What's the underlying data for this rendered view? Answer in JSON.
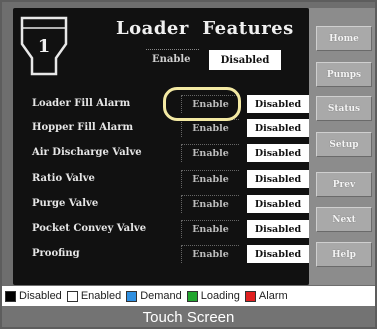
{
  "header": {
    "title": "Loader  Features",
    "loader_number": "1",
    "enable_label": "Enable",
    "disabled_label": "Disabled"
  },
  "rows": [
    {
      "label": "Loader Fill Alarm",
      "enable": "Enable",
      "disabled": "Disabled"
    },
    {
      "label": "Hopper Fill Alarm",
      "enable": "Enable",
      "disabled": "Disabled"
    },
    {
      "label": "Air Discharge Valve",
      "enable": "Enable",
      "disabled": "Disabled"
    },
    {
      "label": "Ratio Valve",
      "enable": "Enable",
      "disabled": "Disabled"
    },
    {
      "label": "Purge Valve",
      "enable": "Enable",
      "disabled": "Disabled"
    },
    {
      "label": "Pocket Convey Valve",
      "enable": "Enable",
      "disabled": "Disabled"
    },
    {
      "label": "Proofing",
      "enable": "Enable",
      "disabled": "Disabled"
    }
  ],
  "nav": [
    "Home",
    "Pumps",
    "Status",
    "Setup",
    "Prev",
    "Next",
    "Help"
  ],
  "legend": [
    {
      "label": "Disabled",
      "color": "#000000"
    },
    {
      "label": "Enabled",
      "color": "#ffffff"
    },
    {
      "label": "Demand",
      "color": "#2f8fe0"
    },
    {
      "label": "Loading",
      "color": "#22a52f"
    },
    {
      "label": "Alarm",
      "color": "#e02020"
    }
  ],
  "footer": "Touch Screen",
  "colors": {
    "highlight": "#f3e9a3",
    "panel": "#111111",
    "side": "#8c8c8c"
  }
}
